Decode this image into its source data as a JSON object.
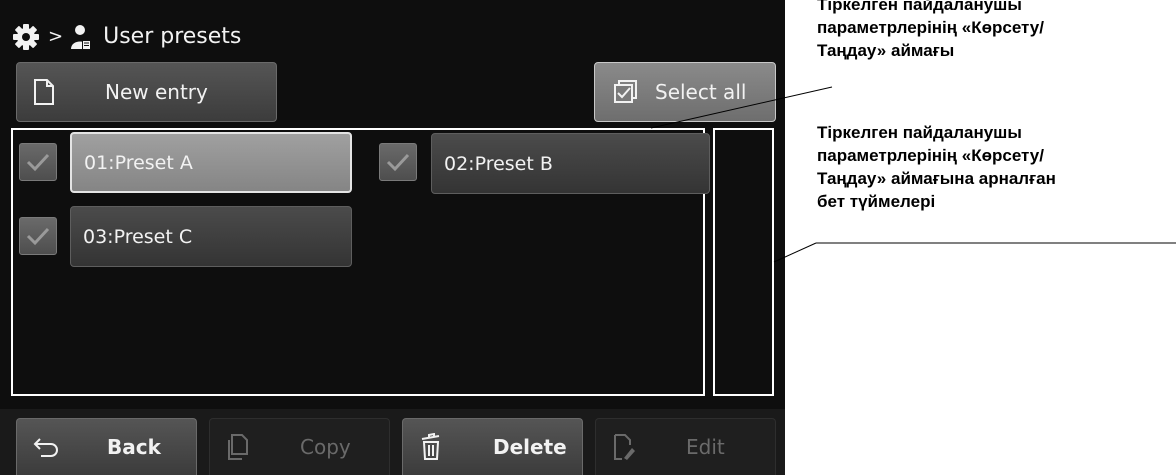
{
  "header": {
    "separator": ">",
    "title": "User presets",
    "icons": [
      "gear-icon",
      "user-presets-icon"
    ]
  },
  "toolbar": {
    "new_entry_label": "New entry",
    "select_all_label": "Select all"
  },
  "presets": [
    {
      "label": "01:Preset A",
      "checked": true,
      "selected": true
    },
    {
      "label": "02:Preset B",
      "checked": true,
      "selected": false
    },
    {
      "label": "03:Preset C",
      "checked": true,
      "selected": false
    }
  ],
  "bottom_bar": {
    "back_label": "Back",
    "copy_label": "Copy",
    "delete_label": "Delete",
    "edit_label": "Edit",
    "copy_enabled": false,
    "edit_enabled": false
  },
  "annotations": {
    "display_area": "Тіркелген пайдаланушы\nпараметрлерінің «Көрсету/\nТаңдау» аймағы",
    "page_buttons": "Тіркелген пайдаланушы\nпараметрлерінің «Көрсету/\nТаңдау» аймағына арналған\nбет түймелері"
  },
  "colors": {
    "screen_bg": "#0e0e0e",
    "button": "#454545",
    "selected": "#929292",
    "text": "#f2f2f2",
    "disabled_text": "#6a6a6a"
  }
}
